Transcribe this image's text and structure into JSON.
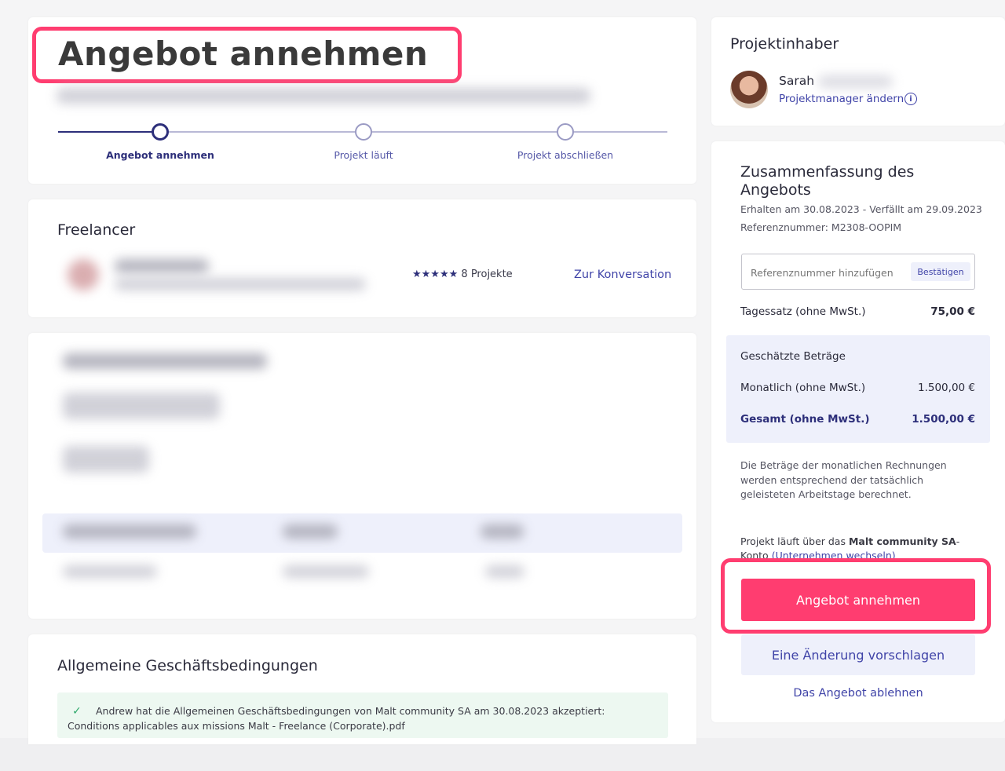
{
  "header": {
    "title": "Angebot annehmen",
    "steps": [
      {
        "label": "Angebot annehmen"
      },
      {
        "label": "Projekt läuft"
      },
      {
        "label": "Projekt abschließen"
      }
    ]
  },
  "freelancer": {
    "heading": "Freelancer",
    "stars": "★★★★★",
    "projects": "8 Projekte",
    "conversation_link": "Zur Konversation"
  },
  "terms": {
    "heading": "Allgemeine Geschäftsbedingungen",
    "check": "✓",
    "text": "Andrew hat die Allgemeinen Geschäftsbedingungen von Malt community SA am 30.08.2023 akzeptiert: Conditions applicables aux missions Malt - Freelance (Corporate).pdf"
  },
  "owner": {
    "heading": "Projektinhaber",
    "name": "Sarah",
    "change_manager": "Projektmanager ändern",
    "info_icon": "i"
  },
  "summary": {
    "heading": "Zusammenfassung des Angebots",
    "received": "Erhalten am 30.08.2023 - Verfällt am 29.09.2023",
    "reference": "Referenznummer: M2308-OOPIM",
    "ref_placeholder": "Referenznummer hinzufügen",
    "confirm": "Bestätigen",
    "daily_rate_label": "Tagessatz (ohne MwSt.)",
    "daily_rate_value": "75,00 €",
    "estimated_heading": "Geschätzte Beträge",
    "monthly_label": "Monatlich (ohne MwSt.)",
    "monthly_value": "1.500,00 €",
    "total_label": "Gesamt (ohne MwSt.)",
    "total_value": "1.500,00 €",
    "note": "Die Beträge der monatlichen Rechnungen werden entsprechend der tatsächlich geleisteten Arbeitstage berechnet.",
    "account_prefix": "Projekt läuft über das ",
    "account_name": "Malt community SA",
    "account_suffix": "-Konto",
    "switch_company": "(Unternehmen wechseln)",
    "accept_button": "Angebot annehmen",
    "suggest_button": "Eine Änderung vorschlagen",
    "decline_link": "Das Angebot ablehnen"
  },
  "colors": {
    "accent": "#ff3d70",
    "primary": "#2d2f7a",
    "link": "#4044a8"
  }
}
